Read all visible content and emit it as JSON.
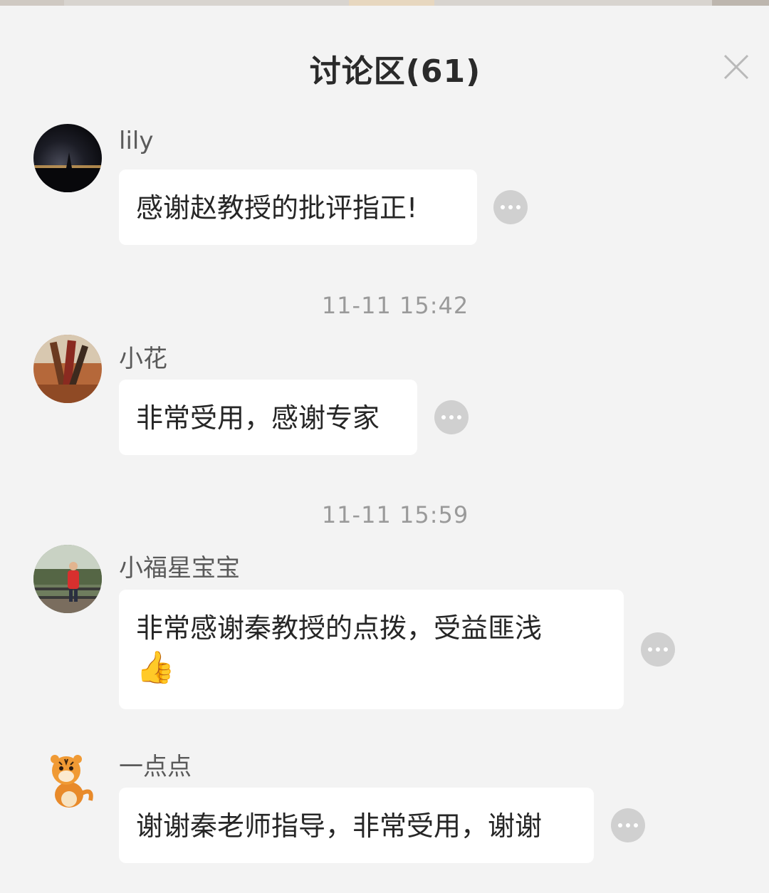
{
  "header": {
    "title": "讨论区(61)",
    "close_icon": "close-icon"
  },
  "comments": [
    {
      "username": "lily",
      "text": "感谢赵教授的批评指正!",
      "avatar_icon": "avatar-night-landscape",
      "more_icon": "more-options-icon"
    },
    {
      "username": "小花",
      "text": "非常受用，感谢专家",
      "avatar_icon": "avatar-photo",
      "more_icon": "more-options-icon"
    },
    {
      "username": "小福星宝宝",
      "text": "非常感谢秦教授的点拨，受益匪浅",
      "emoji": "👍",
      "avatar_icon": "avatar-child-photo",
      "more_icon": "more-options-icon"
    },
    {
      "username": "一点点",
      "text": "谢谢秦老师指导，非常受用，谢谢",
      "avatar_icon": "avatar-tiger-cartoon",
      "more_icon": "more-options-icon"
    }
  ],
  "timestamps": [
    "11-11 15:42",
    "11-11 15:59"
  ],
  "colors": {
    "background": "#f3f3f3",
    "bubble": "#ffffff",
    "title": "#2a2a2a",
    "username": "#5a5a5a",
    "timestamp": "#9a9a9a",
    "more_button": "#d0d0d0"
  }
}
